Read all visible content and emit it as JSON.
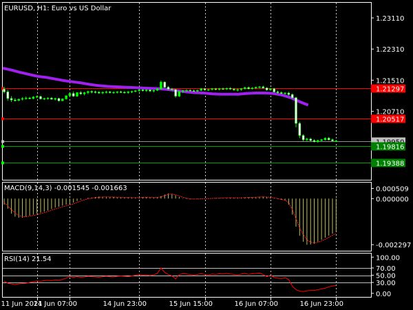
{
  "colors": {
    "background": "#000000",
    "frame": "#ffffff",
    "grid": "#c8c8c8",
    "candle": "#00ff00",
    "candle_bear": "#ffffff",
    "ma": "#a020f0",
    "red_level": "#ff0000",
    "green_level": "#00a000",
    "macd_hist": "#c0c060",
    "macd_signal": "#ff2020",
    "rsi_line": "#ff0000",
    "rsi_levels": "#c0c0c0",
    "bid_tag": "#c0c0c0",
    "red_tag": "#ff0000",
    "green_tag": "#008000"
  },
  "main_panel": {
    "title": "EURUSD, H1:  Euro vs US Dollar"
  },
  "macd_panel": {
    "title": "MACD(9,14,3) -0.001545 -0.001663"
  },
  "rsi_panel": {
    "title": "RSI(14) 21.54"
  },
  "chart_data": [
    {
      "type": "candlestick",
      "title": "EURUSD, H1:  Euro vs US Dollar",
      "ylim": [
        1.1895,
        1.235
      ],
      "y_ticks": [
        "1.23110",
        "1.22310",
        "1.21510",
        "1.20710"
      ],
      "y_tick_values": [
        1.2311,
        1.2231,
        1.2151,
        1.2071
      ],
      "x_ticks": [
        "11 Jun 2021",
        "14 Jun 07:00",
        "14 Jun 23:00",
        "15 Jun 15:00",
        "16 Jun 07:00",
        "16 Jun 23:00"
      ],
      "grid": true,
      "price_levels": [
        {
          "label": "1.21297",
          "value": 1.21297,
          "color": "red"
        },
        {
          "label": "1.20517",
          "value": 1.20517,
          "color": "red"
        },
        {
          "label": "1.19950",
          "value": 1.1995,
          "color": "bid"
        },
        {
          "label": "1.19816",
          "value": 1.19816,
          "color": "green"
        },
        {
          "label": "1.19388",
          "value": 1.19388,
          "color": "green"
        }
      ],
      "candles": [
        [
          1.2128,
          1.2134,
          1.2117,
          1.2121
        ],
        [
          1.2121,
          1.2126,
          1.2098,
          1.2104
        ],
        [
          1.2104,
          1.211,
          1.2095,
          1.21
        ],
        [
          1.21,
          1.2105,
          1.2096,
          1.2099
        ],
        [
          1.2099,
          1.2104,
          1.2097,
          1.2102
        ],
        [
          1.2102,
          1.2107,
          1.2099,
          1.2104
        ],
        [
          1.2104,
          1.2109,
          1.2101,
          1.2105
        ],
        [
          1.2105,
          1.2108,
          1.2102,
          1.2104
        ],
        [
          1.2104,
          1.211,
          1.2102,
          1.2108
        ],
        [
          1.2108,
          1.2112,
          1.2105,
          1.2109
        ],
        [
          1.2109,
          1.2111,
          1.2101,
          1.2103
        ],
        [
          1.2103,
          1.2106,
          1.21,
          1.2104
        ],
        [
          1.2104,
          1.2107,
          1.2101,
          1.2105
        ],
        [
          1.2105,
          1.2108,
          1.2101,
          1.2102
        ],
        [
          1.2102,
          1.2106,
          1.2099,
          1.2104
        ],
        [
          1.2104,
          1.2106,
          1.2096,
          1.2098
        ],
        [
          1.2098,
          1.2104,
          1.2097,
          1.2103
        ],
        [
          1.2103,
          1.2112,
          1.2101,
          1.2111
        ],
        [
          1.2111,
          1.2119,
          1.2108,
          1.2117
        ],
        [
          1.2117,
          1.2122,
          1.2108,
          1.211
        ],
        [
          1.211,
          1.212,
          1.2108,
          1.2119
        ],
        [
          1.2119,
          1.2123,
          1.2113,
          1.2116
        ],
        [
          1.2116,
          1.2121,
          1.2112,
          1.2119
        ],
        [
          1.2119,
          1.2124,
          1.2115,
          1.2122
        ],
        [
          1.2122,
          1.2125,
          1.2117,
          1.2121
        ],
        [
          1.2121,
          1.2124,
          1.2117,
          1.212
        ],
        [
          1.212,
          1.2123,
          1.2116,
          1.2118
        ],
        [
          1.2118,
          1.2122,
          1.2115,
          1.212
        ],
        [
          1.212,
          1.2124,
          1.2117,
          1.2121
        ],
        [
          1.2121,
          1.2123,
          1.2117,
          1.2119
        ],
        [
          1.2119,
          1.2122,
          1.2116,
          1.212
        ],
        [
          1.212,
          1.2123,
          1.2117,
          1.2121
        ],
        [
          1.2121,
          1.2124,
          1.2118,
          1.212
        ],
        [
          1.212,
          1.2123,
          1.2117,
          1.2119
        ],
        [
          1.2119,
          1.2123,
          1.2116,
          1.2121
        ],
        [
          1.2121,
          1.2124,
          1.2118,
          1.2122
        ],
        [
          1.2122,
          1.2126,
          1.212,
          1.2124
        ],
        [
          1.2124,
          1.2129,
          1.2121,
          1.2126
        ],
        [
          1.2126,
          1.2128,
          1.2122,
          1.2124
        ],
        [
          1.2124,
          1.2128,
          1.2121,
          1.2126
        ],
        [
          1.2126,
          1.2128,
          1.2121,
          1.2123
        ],
        [
          1.2123,
          1.2127,
          1.212,
          1.2125
        ],
        [
          1.2125,
          1.2131,
          1.2123,
          1.2129
        ],
        [
          1.2129,
          1.215,
          1.2127,
          1.2146
        ],
        [
          1.2146,
          1.2148,
          1.2131,
          1.2133
        ],
        [
          1.2133,
          1.2136,
          1.2125,
          1.2128
        ],
        [
          1.2128,
          1.2131,
          1.2124,
          1.2127
        ],
        [
          1.2127,
          1.2129,
          1.2106,
          1.211
        ],
        [
          1.211,
          1.2124,
          1.2108,
          1.2122
        ],
        [
          1.2122,
          1.2126,
          1.2118,
          1.2124
        ],
        [
          1.2124,
          1.2128,
          1.2121,
          1.2125
        ],
        [
          1.2125,
          1.2128,
          1.2122,
          1.2124
        ],
        [
          1.2124,
          1.2127,
          1.2121,
          1.2123
        ],
        [
          1.2123,
          1.2127,
          1.212,
          1.2125
        ],
        [
          1.2125,
          1.2131,
          1.2123,
          1.2129
        ],
        [
          1.2129,
          1.2131,
          1.2124,
          1.2126
        ],
        [
          1.2126,
          1.2129,
          1.2123,
          1.2127
        ],
        [
          1.2127,
          1.2131,
          1.2125,
          1.2129
        ],
        [
          1.2129,
          1.2131,
          1.2125,
          1.2127
        ],
        [
          1.2127,
          1.2131,
          1.2125,
          1.2129
        ],
        [
          1.2129,
          1.2132,
          1.2126,
          1.2128
        ],
        [
          1.2128,
          1.2132,
          1.2126,
          1.213
        ],
        [
          1.213,
          1.2133,
          1.2126,
          1.2128
        ],
        [
          1.2128,
          1.2131,
          1.2124,
          1.2126
        ],
        [
          1.2126,
          1.213,
          1.2122,
          1.2127
        ],
        [
          1.2127,
          1.2131,
          1.2124,
          1.2129
        ],
        [
          1.2129,
          1.2134,
          1.2127,
          1.2132
        ],
        [
          1.2132,
          1.2135,
          1.2127,
          1.2129
        ],
        [
          1.2129,
          1.2133,
          1.2127,
          1.2131
        ],
        [
          1.2131,
          1.2134,
          1.2128,
          1.2133
        ],
        [
          1.2133,
          1.2136,
          1.213,
          1.2134
        ],
        [
          1.2134,
          1.2137,
          1.2129,
          1.2131
        ],
        [
          1.2131,
          1.2133,
          1.2124,
          1.2126
        ],
        [
          1.2126,
          1.2131,
          1.2124,
          1.2129
        ],
        [
          1.2129,
          1.2131,
          1.2119,
          1.2121
        ],
        [
          1.2121,
          1.2124,
          1.2116,
          1.2119
        ],
        [
          1.2119,
          1.2122,
          1.2115,
          1.2117
        ],
        [
          1.2117,
          1.212,
          1.2114,
          1.2118
        ],
        [
          1.2118,
          1.2121,
          1.2111,
          1.2114
        ],
        [
          1.2114,
          1.2117,
          1.2103,
          1.2106
        ],
        [
          1.2106,
          1.2108,
          1.203,
          1.204
        ],
        [
          1.204,
          1.2044,
          1.2002,
          1.2009
        ],
        [
          1.2009,
          1.2012,
          1.1994,
          1.1998
        ],
        [
          1.1998,
          1.2003,
          1.1994,
          1.2
        ],
        [
          1.2,
          1.2003,
          1.1993,
          1.1996
        ],
        [
          1.1996,
          1.1999,
          1.1991,
          1.1993
        ],
        [
          1.1993,
          1.1998,
          1.199,
          1.1996
        ],
        [
          1.1996,
          1.2,
          1.1993,
          1.1998
        ],
        [
          1.1998,
          1.2004,
          1.1996,
          1.2002
        ],
        [
          1.2002,
          1.2005,
          1.1996,
          1.1998
        ],
        [
          1.1998,
          1.2001,
          1.1994,
          1.1995
        ],
        [
          1.1995,
          1.1998,
          1.1992,
          1.1995
        ]
      ],
      "ma_values": [
        1.2182,
        1.2177,
        1.2171,
        1.2166,
        1.2161,
        1.2158,
        1.2154,
        1.215,
        1.2147,
        1.2144,
        1.214,
        1.2137,
        1.2135,
        1.2134,
        1.2133,
        1.2132,
        1.2131,
        1.213,
        1.2129,
        1.2127,
        1.2124,
        1.2121,
        1.2119,
        1.2118,
        1.2116,
        1.2115,
        1.2115,
        1.2115,
        1.2117,
        1.2118,
        1.2118,
        1.2117,
        1.2113,
        1.2106,
        1.2096,
        1.2087
      ]
    },
    {
      "type": "bar",
      "title": "MACD(9,14,3) -0.001545 -0.001663",
      "ylim": [
        -0.0026,
        0.0008
      ],
      "y_ticks": [
        "0.000509",
        "0.000000",
        "-0.002297"
      ],
      "y_tick_values": [
        0.000509,
        0.0,
        -0.002297
      ],
      "series": [
        {
          "name": "",
          "values": [
            -0.0003,
            -0.0005,
            -0.00075,
            -0.0009,
            -0.00095,
            -0.00095,
            -0.0009,
            -0.00085,
            -0.0008,
            -0.00075,
            -0.0007,
            -0.00065,
            -0.0006,
            -0.00052,
            -0.00045,
            -0.0004,
            -0.00035,
            -0.0003,
            -0.00025,
            -0.0002,
            -0.00012,
            -5e-05,
            0.0,
            4e-05,
            6e-05,
            8e-05,
            0.0001,
            0.0001,
            9e-05,
            8e-05,
            8e-05,
            7e-05,
            6e-05,
            6e-05,
            5e-05,
            5e-05,
            5e-05,
            6e-05,
            8e-05,
            8e-05,
            7e-05,
            6e-05,
            7e-05,
            0.00012,
            0.0002,
            0.00026,
            0.00024,
            0.00016,
            8e-05,
            2e-05,
            -2e-05,
            -4e-05,
            -3e-05,
            -2e-05,
            -1e-05,
            0.0,
            1e-05,
            2e-05,
            2e-05,
            3e-05,
            4e-05,
            4e-05,
            4e-05,
            4e-05,
            4e-05,
            5e-05,
            6e-05,
            6e-05,
            7e-05,
            8e-05,
            9e-05,
            9e-05,
            7e-05,
            5e-05,
            2e-05,
            -2e-05,
            -6e-05,
            -0.0001,
            -0.0003,
            -0.0008,
            -0.0014,
            -0.00185,
            -0.00215,
            -0.0023,
            -0.00229,
            -0.00225,
            -0.00215,
            -0.00205,
            -0.00195,
            -0.00185,
            -0.00175,
            -0.00165
          ]
        },
        {
          "name": "",
          "values": [
            -0.0002,
            -0.00035,
            -0.00055,
            -0.00072,
            -0.00084,
            -0.0009,
            -0.0009,
            -0.00088,
            -0.00084,
            -0.0008,
            -0.00075,
            -0.0007,
            -0.00065,
            -0.00058,
            -0.00052,
            -0.00046,
            -0.00041,
            -0.00036,
            -0.00031,
            -0.00026,
            -0.00019,
            -0.00012,
            -6e-05,
            -1e-05,
            2e-05,
            5e-05,
            7e-05,
            8e-05,
            9e-05,
            8e-05,
            8e-05,
            7e-05,
            7e-05,
            6e-05,
            6e-05,
            5e-05,
            5e-05,
            5e-05,
            6e-05,
            7e-05,
            7e-05,
            6e-05,
            6e-05,
            9e-05,
            0.00015,
            0.00021,
            0.00023,
            0.00019,
            0.00013,
            7e-05,
            2e-05,
            -1e-05,
            -2e-05,
            -2e-05,
            -1e-05,
            0.0,
            0.0,
            1e-05,
            2e-05,
            2e-05,
            3e-05,
            4e-05,
            4e-05,
            4e-05,
            4e-05,
            4e-05,
            5e-05,
            6e-05,
            6e-05,
            7e-05,
            8e-05,
            9e-05,
            8e-05,
            6e-05,
            4e-05,
            0.0,
            -4e-05,
            -8e-05,
            -0.0002,
            -0.00055,
            -0.001,
            -0.00145,
            -0.0018,
            -0.00205,
            -0.00217,
            -0.00221,
            -0.00218,
            -0.00211,
            -0.00203,
            -0.00193,
            -0.00183,
            -0.00173
          ]
        }
      ]
    },
    {
      "type": "line",
      "title": "RSI(14) 21.54",
      "ylim": [
        -10,
        110
      ],
      "y_ticks": [
        "100.00",
        "70.00",
        "50.00",
        "30.00",
        "0.00"
      ],
      "y_tick_values": [
        100,
        70,
        50,
        30,
        0
      ],
      "levels": [
        70,
        50,
        30
      ],
      "series": [
        {
          "name": "",
          "values": [
            34,
            28,
            26,
            24,
            26,
            27,
            28,
            30,
            32,
            34,
            33,
            35,
            36,
            35,
            37,
            36,
            38,
            42,
            46,
            44,
            46,
            44,
            45,
            47,
            46,
            45,
            44,
            46,
            47,
            46,
            45,
            47,
            48,
            47,
            46,
            48,
            50,
            52,
            50,
            51,
            49,
            51,
            55,
            70,
            58,
            52,
            48,
            40,
            52,
            54,
            53,
            52,
            50,
            52,
            54,
            52,
            51,
            53,
            52,
            54,
            53,
            55,
            53,
            52,
            51,
            53,
            55,
            52,
            54,
            55,
            56,
            52,
            46,
            50,
            44,
            42,
            41,
            43,
            38,
            20,
            10,
            6,
            5,
            7,
            8,
            8,
            10,
            12,
            14,
            18,
            20,
            22
          ]
        }
      ]
    }
  ]
}
